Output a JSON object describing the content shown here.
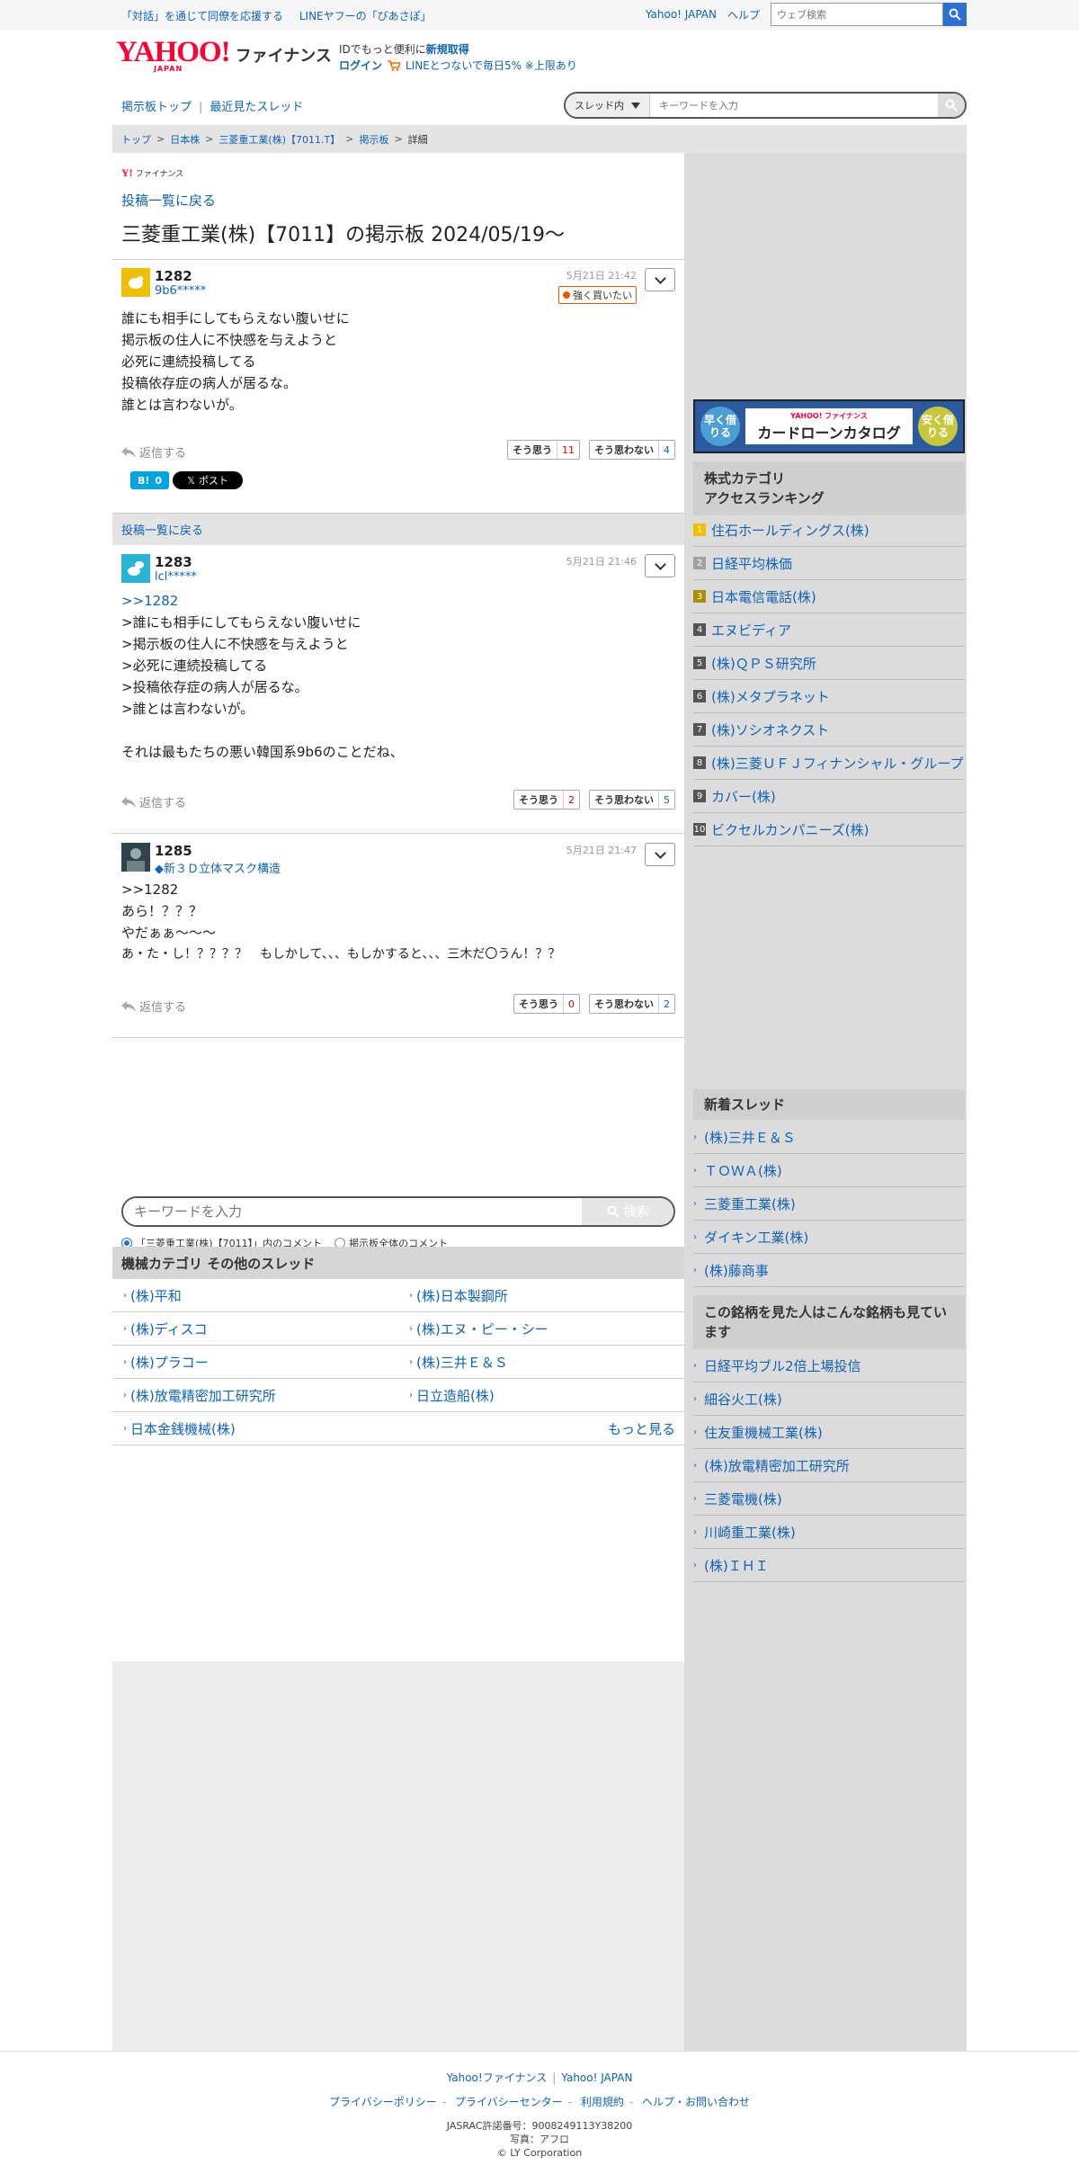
{
  "topbar": {
    "promo1": "「対話」を通じて同僚を応援する",
    "promo2": "LINEヤフーの「ぴあさぽ」",
    "yahoo_japan": "Yahoo! JAPAN",
    "help": "ヘルプ",
    "web_search_placeholder": "ウェブ検索"
  },
  "header": {
    "logo_text": "YAHOO!",
    "logo_sub": "JAPAN",
    "service_name": "ファイナンス",
    "id_text": "IDでもっと便利に",
    "signup": "新規取得",
    "login": "ログイン",
    "line_promo": "LINEとつないで毎日5% ※上限あり"
  },
  "nav": {
    "bbs_top": "掲示板トップ",
    "recent": "最近見たスレッド",
    "search_scope": "スレッド内",
    "search_placeholder": "キーワードを入力"
  },
  "breadcrumb": [
    "トップ",
    "日本株",
    "三菱重工業(株)【7011.T】",
    "掲示板",
    "詳細"
  ],
  "main": {
    "mini_logo_brand": "Y!",
    "mini_logo_text": "ファイナンス",
    "back_to_list": "投稿一覧に戻る",
    "thread_title": "三菱重工業(株)【7011】の掲示板 2024/05/19〜",
    "reply_label": "返信する",
    "agree_label": "そう思う",
    "disagree_label": "そう思わない",
    "hatena_label": "B!",
    "hatena_count": "0",
    "x_post_label": "ポスト",
    "posts": [
      {
        "number": "1282",
        "user": "9b6*****",
        "time": "5月21日 21:42",
        "badge": "強く買いたい",
        "lines": [
          "誰にも相手にしてもらえない腹いせに",
          "掲示板の住人に不快感を与えようと",
          "必死に連続投稿してる",
          "投稿依存症の病人が居るな。",
          "誰とは言わないが。"
        ],
        "agree": "11",
        "disagree": "4"
      },
      {
        "number": "1283",
        "user": "lcl*****",
        "time": "5月21日 21:46",
        "lines": [
          ">>1282",
          ">誰にも相手にしてもらえない腹いせに",
          ">掲示板の住人に不快感を与えようと",
          ">必死に連続投稿してる",
          ">投稿依存症の病人が居るな。",
          ">誰とは言わないが。",
          "",
          "それは最もたちの悪い韓国系9b6のことだね、"
        ],
        "agree": "2",
        "disagree": "5"
      },
      {
        "number": "1285",
        "user": "◆新３Ｄ立体マスク構造",
        "time": "5月21日 21:47",
        "lines": [
          ">>1282",
          "あら！？？？",
          "やだぁぁ〜〜〜",
          "あ・た・し！？？？？　もしかして、、、もしかすると、、、三木だ〇うん！？？"
        ],
        "agree": "0",
        "disagree": "2"
      }
    ],
    "kw_placeholder": "キーワードを入力",
    "kw_button": "検索",
    "scope_this": "「三菱重工業(株)【7011】」内のコメント",
    "scope_all": "掲示板全体のコメント",
    "category_heading": "機械カテゴリ  その他のスレッド",
    "category_threads": [
      "(株)平和",
      "(株)日本製鋼所",
      "(株)ディスコ",
      "(株)エヌ・ピー・シー",
      "(株)プラコー",
      "(株)三井Ｅ＆Ｓ",
      "(株)放電精密加工研究所",
      "日立造船(株)",
      "日本金銭機械(株)"
    ],
    "more": "もっと見る"
  },
  "side": {
    "ad_left": "早く借りる",
    "ad_brand": "YAHOO! ファイナンス",
    "ad_title": "カードローンカタログ",
    "ad_right": "安く借りる",
    "ranking_heading_1": "株式カテゴリ",
    "ranking_heading_2": "アクセスランキング",
    "ranking": [
      "住石ホールディングス(株)",
      "日経平均株価",
      "日本電信電話(株)",
      "エヌビディア",
      "(株)ＱＰＳ研究所",
      "(株)メタプラネット",
      "(株)ソシオネクスト",
      "(株)三菱ＵＦＪフィナンシャル・グループ",
      "カバー(株)",
      "ビクセルカンパニーズ(株)"
    ],
    "rank_colors": [
      "#f0c000",
      "#a0a0a0",
      "#b08d00",
      "#555555",
      "#555555",
      "#555555",
      "#555555",
      "#555555",
      "#555555",
      "#555555"
    ],
    "new_threads_heading": "新着スレッド",
    "new_threads": [
      "(株)三井Ｅ＆Ｓ",
      "ＴＯＷＡ(株)",
      "三菱重工業(株)",
      "ダイキン工業(株)",
      "(株)藤商事"
    ],
    "also_heading": "この銘柄を見た人はこんな銘柄も見ています",
    "also": [
      "日経平均ブル2倍上場投信",
      "細谷火工(株)",
      "住友重機械工業(株)",
      "(株)放電精密加工研究所",
      "三菱電機(株)",
      "川崎重工業(株)",
      "(株)ＩＨＩ"
    ]
  },
  "footer": {
    "link1": "Yahoo!ファイナンス",
    "link2": "Yahoo! JAPAN",
    "privacy_policy": "プライバシーポリシー",
    "privacy_center": "プライバシーセンター",
    "terms": "利用規約",
    "help_contact": "ヘルプ・お問い合わせ",
    "jasrac": "JASRAC許諾番号：9008249113Y38200",
    "photo": "写真：アフロ",
    "copyright": "© LY Corporation"
  }
}
